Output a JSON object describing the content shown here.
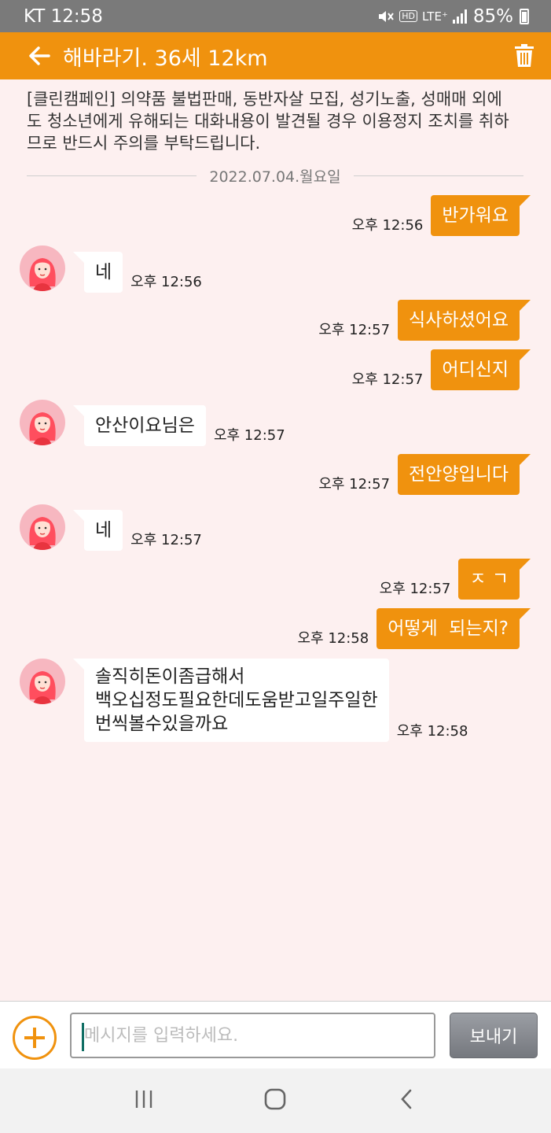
{
  "status_bar": {
    "carrier_time": "KT 12:58",
    "battery_percent": "85%",
    "lte_label": "LTE⁺",
    "hd_label": "HD"
  },
  "app_bar": {
    "title": "해바라기. 36세 12km"
  },
  "notice": "[클린캠페인] 의약품 불법판매, 동반자살 모집, 성기노출, 성매매 외에도 청소년에게 유해되는 대화내용이 발견될 경우 이용정지 조치를 취하므로 반드시 주의를 부탁드립니다.",
  "date_divider": "2022.07.04.월요일",
  "messages": [
    {
      "dir": "out",
      "text": "반가워요",
      "time": "오후 12:56"
    },
    {
      "dir": "in",
      "text": "네",
      "time": "오후 12:56"
    },
    {
      "dir": "out",
      "text": "식사하셨어요",
      "time": "오후 12:57"
    },
    {
      "dir": "out",
      "text": "어디신지",
      "time": "오후 12:57"
    },
    {
      "dir": "in",
      "text": "안산이요님은",
      "time": "오후 12:57"
    },
    {
      "dir": "out",
      "text": "전안양입니다",
      "time": "오후 12:57"
    },
    {
      "dir": "in",
      "text": "네",
      "time": "오후 12:57"
    },
    {
      "dir": "out",
      "text": "ㅈ ㄱ",
      "time": "오후 12:57"
    },
    {
      "dir": "out",
      "text": "어떻게  되는지?",
      "time": "오후 12:58"
    },
    {
      "dir": "in",
      "lines": [
        "솔직히돈이좀급해서",
        "백오십정도필요한데도움받고일주일한",
        "번씩볼수있을까요"
      ],
      "time": "오후 12:58"
    }
  ],
  "composer": {
    "placeholder": "메시지를 입력하세요.",
    "send_label": "보내기"
  },
  "colors": {
    "accent": "#f0920e",
    "background": "#fdf0f0"
  }
}
